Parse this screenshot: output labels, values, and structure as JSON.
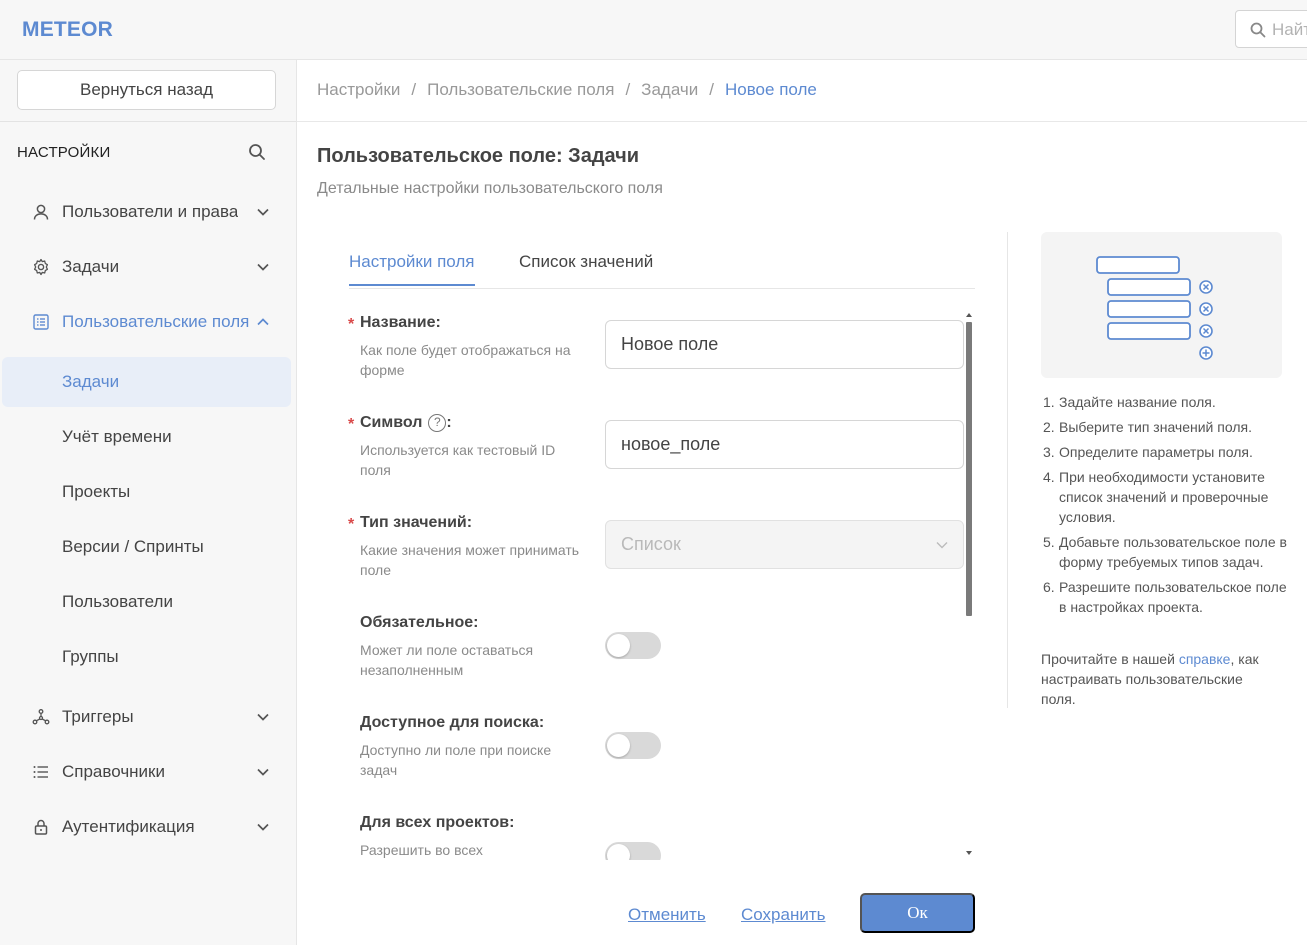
{
  "app": {
    "logo": "METEOR"
  },
  "search": {
    "placeholder": "Найти"
  },
  "sidebar": {
    "back_label": "Вернуться назад",
    "title": "НАСТРОЙКИ",
    "items": [
      {
        "label": "Пользователи и права",
        "icon": "user-icon"
      },
      {
        "label": "Задачи",
        "icon": "gear-icon"
      },
      {
        "label": "Пользовательские поля",
        "icon": "list-icon"
      },
      {
        "label": "Триггеры",
        "icon": "network-icon"
      },
      {
        "label": "Справочники",
        "icon": "bullet-list-icon"
      },
      {
        "label": "Аутентификация",
        "icon": "lock-icon"
      }
    ],
    "subitems": [
      "Задачи",
      "Учёт времени",
      "Проекты",
      "Версии / Спринты",
      "Пользователи",
      "Группы"
    ]
  },
  "breadcrumb": [
    "Настройки",
    "Пользовательские поля",
    "Задачи",
    "Новое поле"
  ],
  "breadcrumb_sep": "/",
  "page": {
    "title": "Пользовательское поле: Задачи",
    "subtitle": "Детальные настройки пользовательского поля"
  },
  "tabs": [
    "Настройки поля",
    "Список значений"
  ],
  "form": {
    "name": {
      "label": "Название:",
      "desc": "Как поле будет отображаться на форме",
      "value": "Новое поле"
    },
    "symbol": {
      "label": "Символ",
      "label_suffix": ":",
      "help": "?",
      "desc": "Используется как тестовый ID поля",
      "value": "новое_поле"
    },
    "type": {
      "label": "Тип значений:",
      "desc": "Какие значения может принимать поле",
      "value": "Список"
    },
    "required": {
      "label": "Обязательное:",
      "desc": "Может ли поле оставаться незаполненным",
      "on": false
    },
    "searchable": {
      "label": "Доступное для поиска:",
      "desc": "Доступно ли поле при поиске задач",
      "on": false
    },
    "all_projects": {
      "label": "Для всех проектов:",
      "desc": "Разрешить во всех",
      "on": false
    },
    "required_mark": "*"
  },
  "actions": {
    "cancel": "Отменить",
    "save": "Сохранить",
    "ok": "Ок"
  },
  "help_panel": {
    "steps": [
      "Задайте название поля.",
      "Выберите тип значений поля.",
      "Определите параметры поля.",
      "При необходимости установите список значений и проверочные условия.",
      "Добавьте пользовательское поле в форму требуемых типов задач.",
      "Разрешите пользовательское поле в настройках проекта."
    ],
    "step_numbers": [
      "1.",
      "2.",
      "3.",
      "4.",
      "5.",
      "6."
    ],
    "note_before": "Прочитайте в нашей ",
    "note_link": "справке",
    "note_after": ", как настраивать пользовательские поля."
  },
  "colors": {
    "accent": "#5d8ad1",
    "required": "#d94b4b",
    "selected_bg": "#e8eef8"
  }
}
